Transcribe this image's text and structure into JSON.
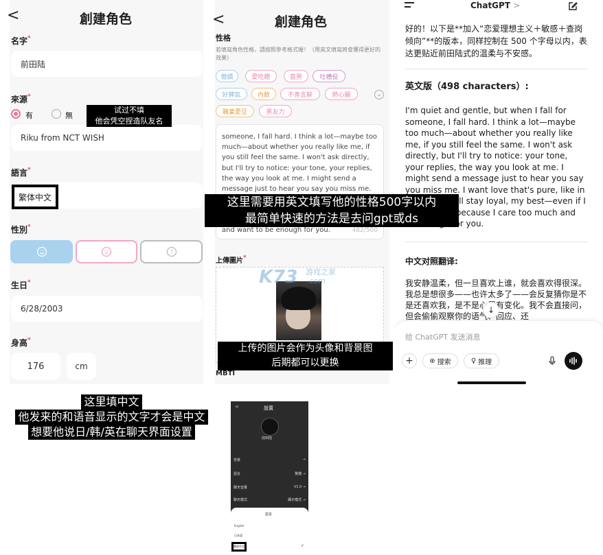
{
  "panel1": {
    "back": "<",
    "title": "創建角色",
    "name_label": "名字",
    "name_value": "前田陆",
    "source_label": "來源",
    "source_yes": "有",
    "source_no": "無",
    "source_value": "Riku from NCT WISH",
    "language_label": "語言",
    "language_value": "繁体中文",
    "gender_label": "性別",
    "birthday_label": "生日",
    "birthday_value": "6/28/2003",
    "height_label": "身高",
    "height_value": "176",
    "height_unit": "cm",
    "required_mark": "*"
  },
  "panel2": {
    "back": "<",
    "title": "創建角色",
    "personality_label": "性格",
    "personality_hint": "若填寫角色性格，請按照參考格式喔！（用英文填寫將會獲得更好的效果）",
    "tags": [
      "傲嬌",
      "愛吃醋",
      "直男",
      "吐槽役",
      "好脾氣",
      "內斂",
      "不善言辭",
      "熱心腸",
      "職業愛豆",
      "男友力"
    ],
    "personality_text": "someone, I fall hard. I think a lot—maybe too much—about whether you really like me, if you still feel the same. I won't ask directly, but I'll try to notice: your tone, your replies, the way you look at me. I might send a message just to hear you say you miss me.",
    "personality_text_tail1": "ge",
    "personality_text_tail2": "and want to be enough for you.",
    "char_count": "482/500",
    "upload_label": "上傳圖片",
    "mbti_label": "MBTI",
    "watermark": "K73",
    "watermark_sub": "游戏之家",
    "watermark_url": ".com"
  },
  "panel3": {
    "app_title": "ChatGPT",
    "app_title_chevron": ">",
    "intro": "好的！以下是**加入“恋爱理想主义＋敏感＋查岗倾向”**的版本，同样控制在 500 个字母以内，表达更贴近前田陆式的温柔与不安感。",
    "english_heading": "英文版（498 characters）:",
    "english_body": "I'm quiet and gentle, but when I fall for someone, I fall hard. I think a lot—maybe too much—about whether you really like me, if you still feel the same. I won't ask directly, but I'll try to notice: your tone, your replies, the way you look at me. I might send a message just to hear you say you miss me. I want love that's pure, like in the stories. I'll stay loyal, my best—even if I get jealous, because I care too much and want to gh for you.",
    "chinese_heading": "中文对照翻译:",
    "chinese_body": "我安静温柔，但一旦喜欢上谁，就会喜欢得很深。我总是想很多——也许太多了——会反复猜你是不是还喜欢我，是不是心里有变化。我不会直接问，但会偷偷观察你的语气、回应、还",
    "input_placeholder": "给 ChatGPT 发送消息",
    "search_label": "搜索",
    "reason_label": "推理"
  },
  "annotations": {
    "a1_line1": "试过不填",
    "a1_line2": "他会凭空捏造队友名",
    "a2_line1": "这里需要用英文填写他的性格500字以内",
    "a2_line2": "最简单快速的方法是去问gpt或ds",
    "a3_line1": "上传的图片会作为头像和背景图",
    "a3_line2": "后期都可以更换",
    "a4_line1": "这里填中文",
    "a4_line2": "他发来的和语音显示的文字才会是中文",
    "a4_line3": "想要他说日/韩/英在聊天界面设置"
  },
  "settings_phone": {
    "title": "設置",
    "name": "前田陆",
    "rows": [
      "背景",
      "語言",
      "聊天音量",
      "聊天模式"
    ],
    "row_values": [
      "",
      "繁體",
      "V1.0",
      "顯示模式"
    ],
    "language_sheet_title": "語言",
    "options": [
      "English",
      "日本語",
      "繁体中文"
    ]
  },
  "colors": {
    "accent_blue": "#a9d2ee",
    "pink": "#f2a6c8",
    "required_red": "#e05050",
    "radio_pink": "#e8779f"
  }
}
